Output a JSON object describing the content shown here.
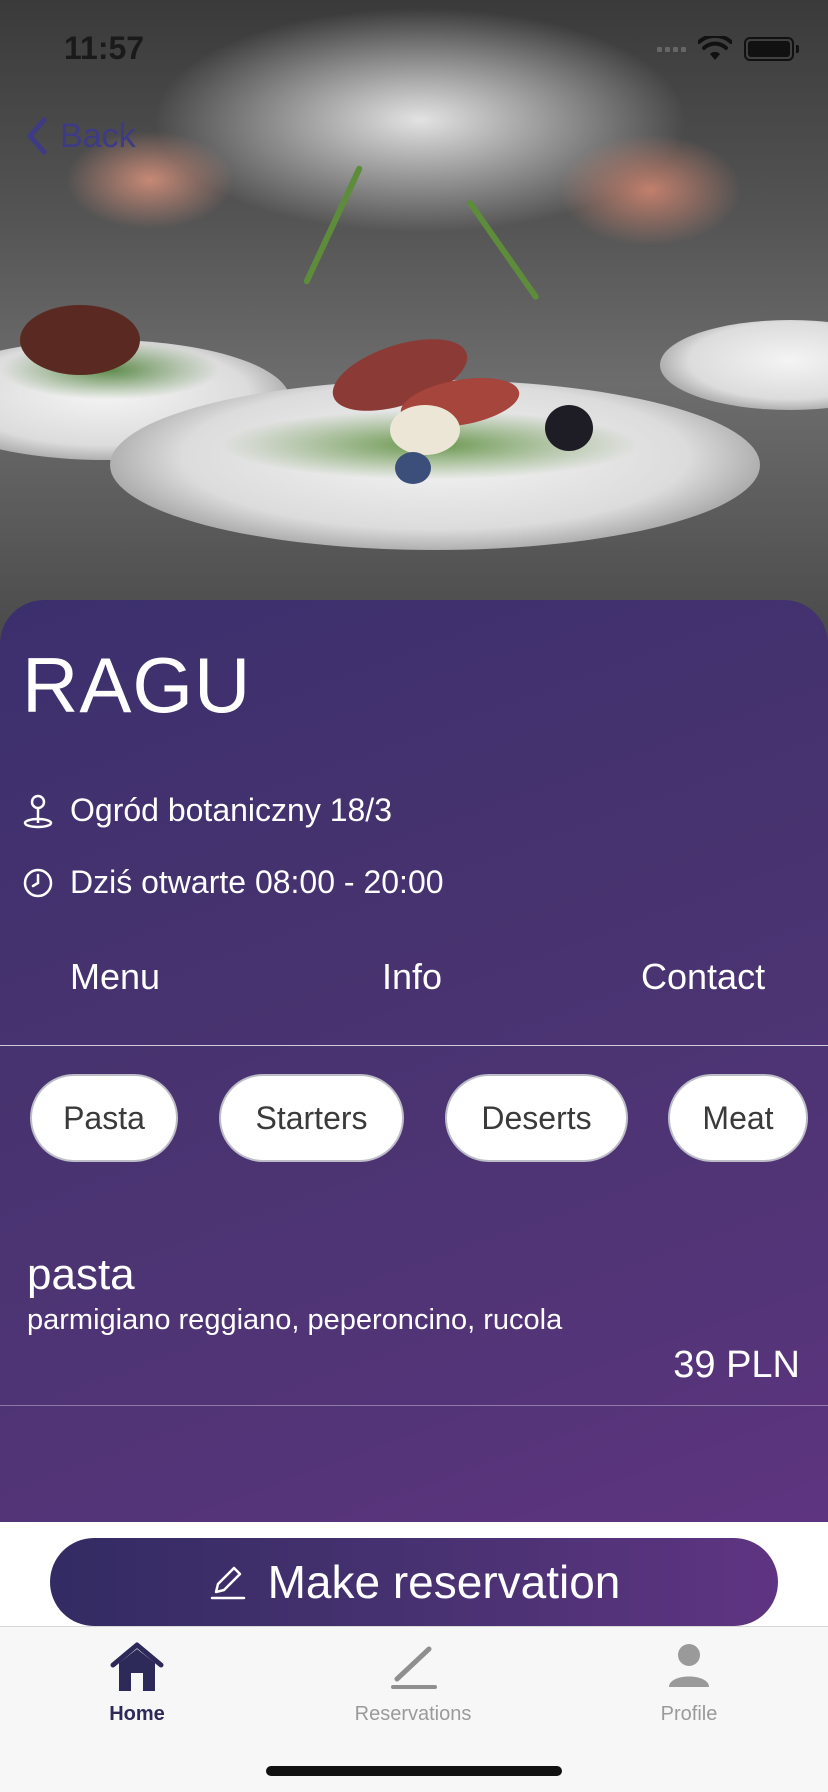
{
  "status_bar": {
    "time": "11:57"
  },
  "navigation": {
    "back_label": "Back"
  },
  "restaurant": {
    "name": "RAGU",
    "address": "Ogród botaniczny 18/3",
    "hours": "Dziś otwarte 08:00 - 20:00"
  },
  "tabs": [
    {
      "label": "Menu"
    },
    {
      "label": "Info"
    },
    {
      "label": "Contact"
    }
  ],
  "categories": [
    {
      "label": "Pasta"
    },
    {
      "label": "Starters"
    },
    {
      "label": "Deserts"
    },
    {
      "label": "Meat"
    }
  ],
  "menu_items": [
    {
      "name": "pasta",
      "description": "parmigiano reggiano, peperoncino, rucola",
      "price": "39 PLN"
    }
  ],
  "reservation": {
    "button_label": "Make reservation"
  },
  "tabbar": [
    {
      "label": "Home",
      "icon": "house-icon",
      "active": true
    },
    {
      "label": "Reservations",
      "icon": "pencil-icon",
      "active": false
    },
    {
      "label": "Profile",
      "icon": "person-icon",
      "active": false
    }
  ],
  "colors": {
    "accent": "#2d2a5a",
    "panel_start": "#3c2f6e",
    "panel_end": "#5e3480",
    "inactive_tab": "#9a9a9a"
  }
}
